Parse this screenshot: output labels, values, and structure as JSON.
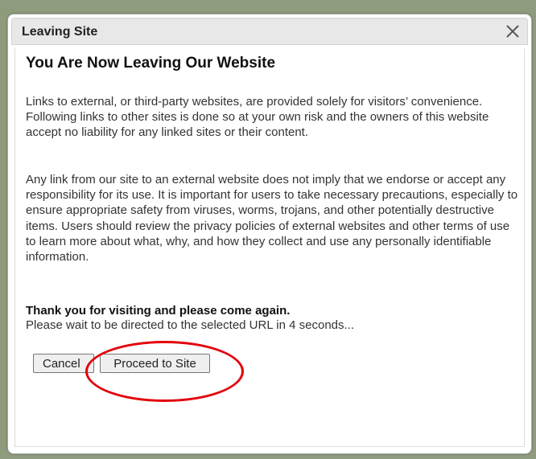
{
  "dialog": {
    "title": "Leaving Site",
    "close_icon": "close-icon"
  },
  "content": {
    "heading": "You Are Now Leaving Our Website",
    "paragraph1": "Links to external, or third-party websites, are provided solely for visitors’ convenience. Following links to other sites is done so at your own risk and the owners of this website accept no liability for any linked sites or their content.",
    "paragraph2": "Any link from our site to an external website does not imply that we endorse or accept any responsibility for its use. It is important for users to take necessary precautions, especially to ensure appropriate safety from viruses, worms, trojans, and other potentially destructive items. Users should review the privacy policies of external websites and other terms of use to learn more about what, why, and how they collect and use any personally identifiable information.",
    "thanks": "Thank you for visiting and please come again.",
    "wait_message": "Please wait to be directed to the selected URL in 4 seconds..."
  },
  "buttons": {
    "cancel_label": "Cancel",
    "proceed_label": "Proceed to Site"
  },
  "colors": {
    "annotation": "#e3000b",
    "backdrop": "#8e9b7c"
  }
}
